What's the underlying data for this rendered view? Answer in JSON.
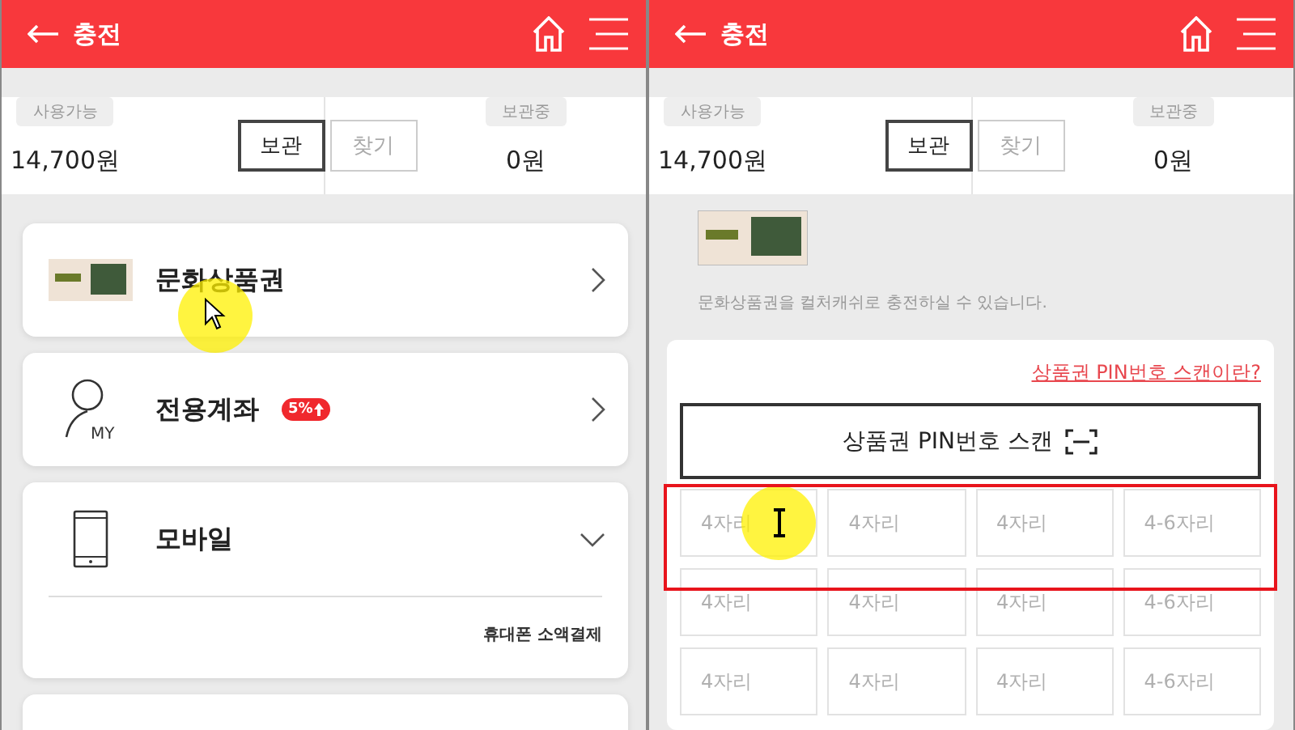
{
  "panels": [
    {
      "kind": "menu",
      "header": {
        "title": "충전"
      },
      "balance": {
        "available_label": "사용가능",
        "available_value": "14,700원",
        "stored_label": "보관중",
        "stored_value": "0원",
        "buttons": [
          {
            "label": "보관",
            "selected": true
          },
          {
            "label": "찾기",
            "selected": false
          }
        ]
      },
      "menu": [
        {
          "kind": "link",
          "title": "문화상품권",
          "cursor_over": true
        },
        {
          "kind": "link",
          "icon_label": "MY",
          "title": "전용계좌",
          "badge": "5%",
          "cursor_over": false
        },
        {
          "kind": "accordion",
          "title": "모바일",
          "expanded": true,
          "sub_items": [
            "휴대폰 소액결제"
          ],
          "cursor_over": false
        },
        {
          "kind": "link",
          "cursor_over": false
        }
      ]
    },
    {
      "kind": "pin",
      "header": {
        "title": "충전"
      },
      "balance": {
        "available_label": "사용가능",
        "available_value": "14,700원",
        "stored_label": "보관중",
        "stored_value": "0원",
        "buttons": [
          {
            "label": "보관",
            "selected": true
          },
          {
            "label": "찾기",
            "selected": false
          }
        ]
      },
      "description": "문화상품권을 컬처캐쉬로 충전하실 수 있습니다.",
      "help_link": "상품권 PIN번호 스캔이란?",
      "scan_button": "상품권 PIN번호 스캔",
      "rows": [
        {
          "highlighted": true,
          "fields": [
            {
              "placeholder": "4자리",
              "cursor_over": true
            },
            {
              "placeholder": "4자리",
              "cursor_over": false
            },
            {
              "placeholder": "4자리",
              "cursor_over": false
            },
            {
              "placeholder": "4-6자리",
              "cursor_over": false
            }
          ]
        },
        {
          "highlighted": false,
          "fields": [
            {
              "placeholder": "4자리",
              "cursor_over": false
            },
            {
              "placeholder": "4자리",
              "cursor_over": false
            },
            {
              "placeholder": "4자리",
              "cursor_over": false
            },
            {
              "placeholder": "4-6자리",
              "cursor_over": false
            }
          ]
        },
        {
          "highlighted": false,
          "fields": [
            {
              "placeholder": "4자리",
              "cursor_over": false
            },
            {
              "placeholder": "4자리",
              "cursor_over": false
            },
            {
              "placeholder": "4자리",
              "cursor_over": false
            },
            {
              "placeholder": "4-6자리",
              "cursor_over": false
            }
          ]
        }
      ]
    }
  ]
}
